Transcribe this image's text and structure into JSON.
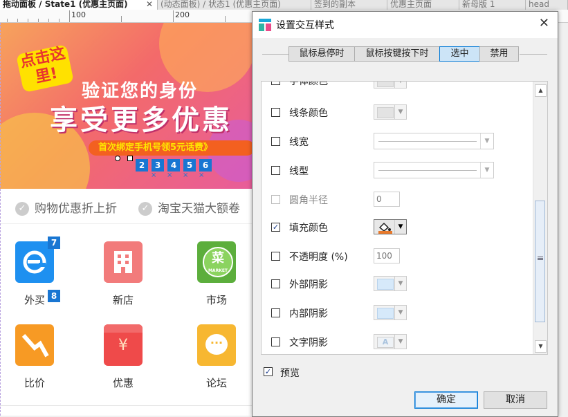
{
  "tabs": [
    {
      "label": "拖动面板 / State1 (优惠主页面)",
      "active": true,
      "close": "✕"
    },
    {
      "label": "(动态面板) / 状态1 (优惠主页面)",
      "active": false
    },
    {
      "label": "签到的副本",
      "active": false
    },
    {
      "label": "优惠主页面",
      "active": false
    },
    {
      "label": "新母版 1",
      "active": false
    },
    {
      "label": "head",
      "active": false
    }
  ],
  "ruler": {
    "labels": [
      "100",
      "200"
    ]
  },
  "canvas": {
    "banner": {
      "badge": "点击这里!",
      "title": "验证您的身份",
      "headline": "享受更多优惠",
      "subline": "首次绑定手机号领5元话费》",
      "markers": [
        "2",
        "3",
        "4",
        "5",
        "6"
      ],
      "x_mark": "×"
    },
    "promo": [
      {
        "check": "✓",
        "label": "购物优惠折上折"
      },
      {
        "check": "✓",
        "label": "淘宝天猫大额卷"
      }
    ],
    "apps": [
      {
        "label": "外买",
        "icon": "waimai-icon",
        "color": "#1e90f0",
        "tags": [
          "7",
          "8"
        ]
      },
      {
        "label": "新店",
        "icon": "store-icon",
        "color": "#f27b7b"
      },
      {
        "label": "市场",
        "icon": "market-icon",
        "color": "#5cae3c",
        "icon_text": "菜",
        "icon_sub": "MARKET"
      },
      {
        "label": "比价",
        "icon": "compare-icon",
        "color": "#f79a24"
      },
      {
        "label": "优惠",
        "icon": "coupon-icon",
        "color": "#ef4a4a",
        "icon_text": "¥"
      },
      {
        "label": "论坛",
        "icon": "forum-icon",
        "color": "#f7b731",
        "icon_text": "···"
      }
    ]
  },
  "dialog": {
    "title": "设置交互样式",
    "close": "✕",
    "tabs": [
      {
        "label": "鼠标悬停时",
        "selected": false
      },
      {
        "label": "鼠标按键按下时",
        "selected": false
      },
      {
        "label": "选中",
        "selected": true
      },
      {
        "label": "禁用",
        "selected": false
      }
    ],
    "properties": [
      {
        "label": "字体颜色",
        "checked": false,
        "control": "color"
      },
      {
        "label": "线条颜色",
        "checked": false,
        "control": "color"
      },
      {
        "label": "线宽",
        "checked": false,
        "control": "dropdown"
      },
      {
        "label": "线型",
        "checked": false,
        "control": "dropdown"
      },
      {
        "label": "圆角半径",
        "checked": false,
        "disabled": true,
        "control": "number",
        "value": "0"
      },
      {
        "label": "填充颜色",
        "checked": true,
        "control": "color-active"
      },
      {
        "label": "不透明度 (%)",
        "checked": false,
        "control": "number",
        "value": "100"
      },
      {
        "label": "外部阴影",
        "checked": false,
        "control": "color"
      },
      {
        "label": "内部阴影",
        "checked": false,
        "control": "color"
      },
      {
        "label": "文字阴影",
        "checked": false,
        "control": "color"
      }
    ],
    "check_mark": "✓",
    "preview": {
      "label": "预览",
      "checked": true
    },
    "ok": "确定",
    "cancel": "取消"
  }
}
